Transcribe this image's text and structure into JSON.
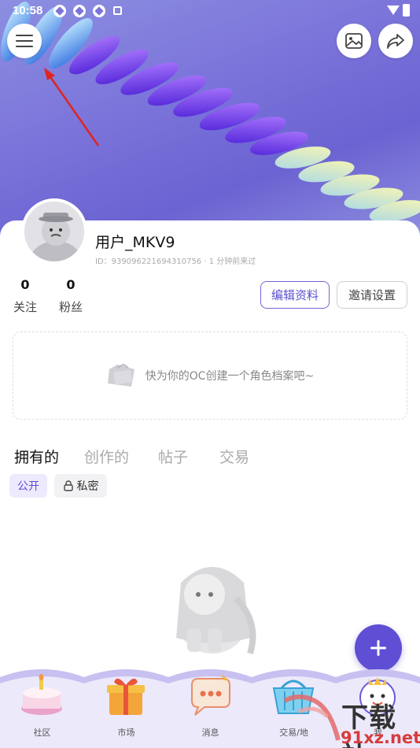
{
  "status_bar": {
    "time": "10:58",
    "icons": [
      "sync-icon",
      "sync-icon",
      "sync-icon",
      "a-icon",
      "wifi-icon",
      "battery-icon"
    ]
  },
  "header": {
    "menu_icon": "menu-icon",
    "image_icon": "image-icon",
    "share_icon": "share-icon"
  },
  "profile": {
    "username": "用户_MKV9",
    "id_line": "ID：939096221694310756 · 1 分钟前来过",
    "stats": [
      {
        "value": "0",
        "label": "关注"
      },
      {
        "value": "0",
        "label": "粉丝"
      }
    ],
    "edit_label": "编辑资料",
    "invite_label": "邀请设置"
  },
  "oc_prompt": "快为你的OC创建一个角色档案吧~",
  "tabs": [
    {
      "label": "拥有的",
      "active": true
    },
    {
      "label": "创作的",
      "active": false
    },
    {
      "label": "帖子",
      "active": false
    },
    {
      "label": "交易",
      "active": false
    }
  ],
  "filters": {
    "public_label": "公开",
    "private_label": "私密"
  },
  "fab_icon": "plus-icon",
  "bottom_nav": [
    {
      "label": "社区",
      "icon": "cake-icon"
    },
    {
      "label": "市场",
      "icon": "gift-icon"
    },
    {
      "label": "消息",
      "icon": "chat-bubble-icon"
    },
    {
      "label": "交易/地",
      "icon": "basket-icon"
    },
    {
      "label": "我",
      "icon": "mascot-icon"
    }
  ],
  "watermark": {
    "big": "下载站",
    "small": "91xz.net"
  },
  "colors": {
    "accent": "#5e4fd4",
    "banner": "#7b74da",
    "active_text": "#111111",
    "inactive_text": "#aaaaaa"
  }
}
